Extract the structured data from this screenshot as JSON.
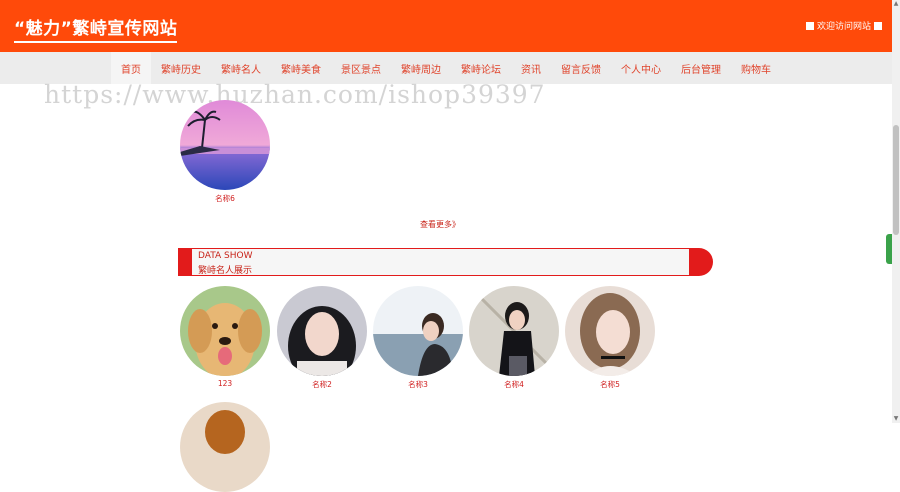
{
  "header": {
    "site_title": "“魅力”繁峙宣传网站",
    "welcome_text": "欢迎访问网站",
    "accent_color": "#ff4a0a"
  },
  "nav": {
    "items": [
      "首页",
      "繁峙历史",
      "繁峙名人",
      "繁峙美食",
      "景区景点",
      "繁峙周边",
      "繁峙论坛",
      "资讯",
      "留言反馈",
      "个人中心",
      "后台管理",
      "购物车"
    ],
    "active": "首页"
  },
  "watermark": "https://www.huzhan.com/ishop39397",
  "section1": {
    "captions": [
      "名称6"
    ],
    "more_label": "查看更多》"
  },
  "section2": {
    "title_en": "DATA SHOW",
    "title_cn": "繁峙名人展示",
    "captions": [
      "123",
      "名称2",
      "名称3",
      "名称4",
      "名称5"
    ]
  },
  "icons": {
    "welcome_left": "square-icon",
    "welcome_right": "square-icon"
  }
}
